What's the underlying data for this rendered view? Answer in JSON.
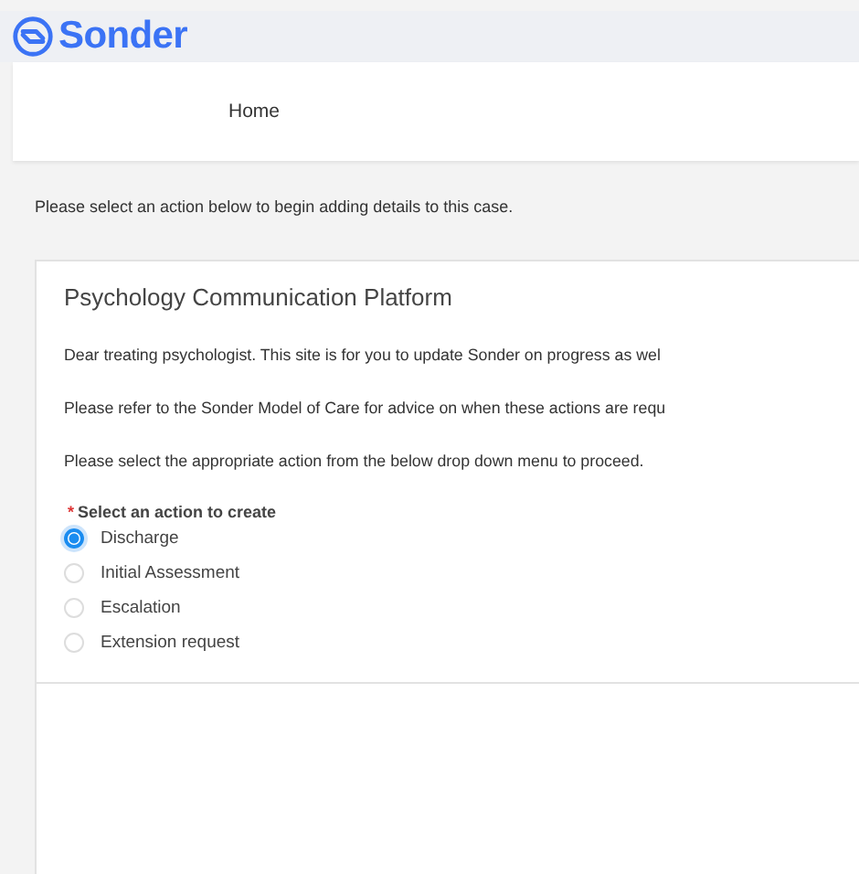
{
  "brand": {
    "name": "Sonder"
  },
  "nav": {
    "items": [
      {
        "label": "Home"
      }
    ]
  },
  "intro": "Please select an action below to begin adding details to this case.",
  "card": {
    "title": "Psychology Communication Platform",
    "paragraphs": [
      "Dear treating psychologist. This site is for you to update Sonder on progress as wel",
      "Please refer to the Sonder Model of Care for advice on when these actions are requ",
      "Please select the appropriate action from the below drop down menu to proceed."
    ],
    "field": {
      "label": "Select an action to create",
      "required_mark": "*",
      "options": [
        {
          "label": "Discharge",
          "selected": true
        },
        {
          "label": "Initial Assessment",
          "selected": false
        },
        {
          "label": "Escalation",
          "selected": false
        },
        {
          "label": "Extension request",
          "selected": false
        }
      ]
    }
  }
}
